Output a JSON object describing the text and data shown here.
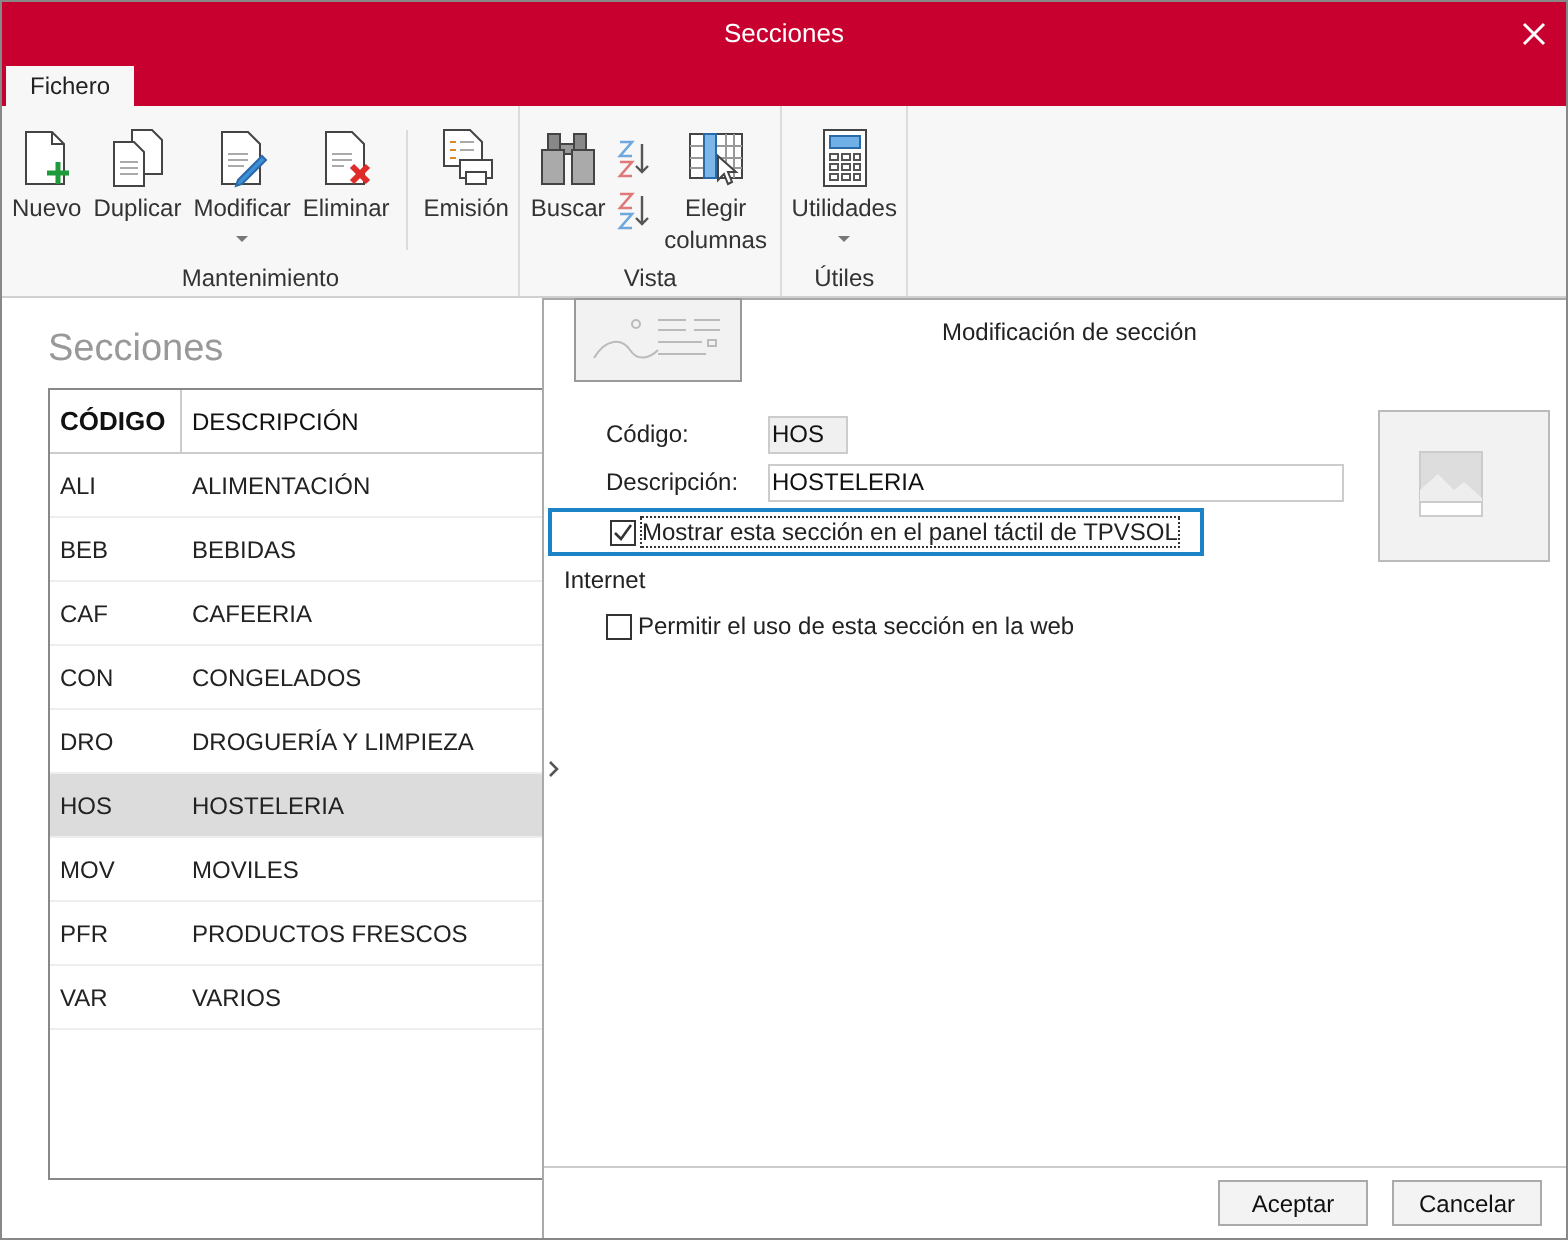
{
  "window": {
    "title": "Secciones"
  },
  "tabs": [
    {
      "label": "Fichero",
      "selected": true
    }
  ],
  "ribbon": {
    "groups": [
      {
        "label": "Mantenimiento",
        "sections": [
          {
            "buttons": [
              {
                "kind": "new",
                "label": "Nuevo",
                "dropdown": false
              },
              {
                "kind": "duplicate",
                "label": "Duplicar",
                "dropdown": false
              },
              {
                "kind": "edit",
                "label": "Modificar",
                "dropdown": true
              },
              {
                "kind": "delete",
                "label": "Eliminar",
                "dropdown": false
              }
            ]
          },
          {
            "buttons": [
              {
                "kind": "print",
                "label": "Emisión",
                "dropdown": false
              }
            ]
          }
        ]
      },
      {
        "label": "Vista",
        "sections": [
          {
            "buttons": [
              {
                "kind": "search",
                "label": "Buscar",
                "dropdown": false
              },
              {
                "kind": "sort"
              },
              {
                "kind": "columns",
                "label": "Elegir columnas",
                "dropdown": false
              }
            ]
          }
        ]
      },
      {
        "label": "Útiles",
        "sections": [
          {
            "buttons": [
              {
                "kind": "calculator",
                "label": "Utilidades",
                "dropdown": true
              }
            ]
          }
        ]
      }
    ]
  },
  "list": {
    "title": "Secciones",
    "columns": [
      "CÓDIGO",
      "DESCRIPCIÓN"
    ],
    "rows": [
      {
        "code": "ALI",
        "description": "ALIMENTACIÓN",
        "selected": false
      },
      {
        "code": "BEB",
        "description": "BEBIDAS",
        "selected": false
      },
      {
        "code": "CAF",
        "description": "CAFEERIA",
        "selected": false
      },
      {
        "code": "CON",
        "description": "CONGELADOS",
        "selected": false
      },
      {
        "code": "DRO",
        "description": "DROGUERÍA Y LIMPIEZA",
        "selected": false
      },
      {
        "code": "HOS",
        "description": "HOSTELERIA",
        "selected": true
      },
      {
        "code": "MOV",
        "description": "MOVILES",
        "selected": false
      },
      {
        "code": "PFR",
        "description": "PRODUCTOS FRESCOS",
        "selected": false
      },
      {
        "code": "VAR",
        "description": "VARIOS",
        "selected": false
      }
    ]
  },
  "detail": {
    "title": "Modificación de sección",
    "code": {
      "label": "Código:",
      "value": "HOS"
    },
    "description": {
      "label": "Descripción:",
      "value": "HOSTELERIA"
    },
    "touch_panel": {
      "label": "Mostrar esta sección en el panel táctil de TPVSOL",
      "checked": true,
      "focused": true
    },
    "internet": {
      "heading": "Internet",
      "web": {
        "label": "Permitir el uso de esta sección en la web",
        "checked": false,
        "focused": false
      }
    }
  },
  "buttons": [
    "Aceptar",
    "Cancelar"
  ]
}
